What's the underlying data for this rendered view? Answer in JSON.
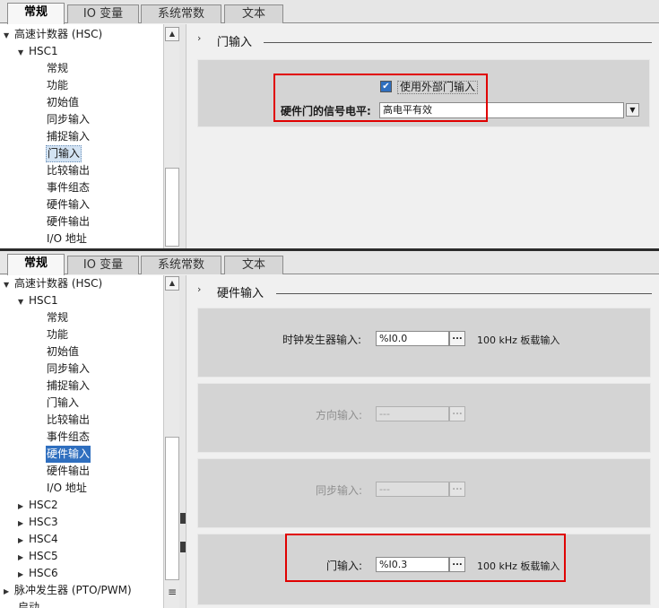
{
  "tabs": [
    "常规",
    "IO 变量",
    "系统常数",
    "文本"
  ],
  "top": {
    "tree": [
      {
        "label": "高速计数器 (HSC)",
        "expander": "▼"
      },
      {
        "label": "HSC1",
        "expander": "▼"
      },
      {
        "label": "常规"
      },
      {
        "label": "功能"
      },
      {
        "label": "初始值"
      },
      {
        "label": "同步输入"
      },
      {
        "label": "捕捉输入"
      },
      {
        "label": "门输入"
      },
      {
        "label": "比较输出"
      },
      {
        "label": "事件组态"
      },
      {
        "label": "硬件输入"
      },
      {
        "label": "硬件输出"
      },
      {
        "label": "I/O 地址"
      }
    ],
    "section_title": "门输入",
    "checkbox_label": "使用外部门输入",
    "checkbox_mark": "✔",
    "signal_level_label": "硬件门的信号电平:",
    "signal_level_value": "高电平有效"
  },
  "bottom": {
    "tree": [
      {
        "label": "高速计数器 (HSC)",
        "expander": "▼"
      },
      {
        "label": "HSC1",
        "expander": "▼"
      },
      {
        "label": "常规"
      },
      {
        "label": "功能"
      },
      {
        "label": "初始值"
      },
      {
        "label": "同步输入"
      },
      {
        "label": "捕捉输入"
      },
      {
        "label": "门输入"
      },
      {
        "label": "比较输出"
      },
      {
        "label": "事件组态"
      },
      {
        "label": "硬件输入"
      },
      {
        "label": "硬件输出"
      },
      {
        "label": "I/O 地址"
      },
      {
        "label": "HSC2",
        "expander": "▶"
      },
      {
        "label": "HSC3",
        "expander": "▶"
      },
      {
        "label": "HSC4",
        "expander": "▶"
      },
      {
        "label": "HSC5",
        "expander": "▶"
      },
      {
        "label": "HSC6",
        "expander": "▶"
      },
      {
        "label": "脉冲发生器 (PTO/PWM)",
        "expander": "▶"
      },
      {
        "label": "启动"
      }
    ],
    "section_title": "硬件输入",
    "rows": {
      "clock": {
        "label": "时钟发生器输入:",
        "value": "%I0.0",
        "note": "100 kHz 板载输入"
      },
      "direction": {
        "label": "方向输入:",
        "value": "---"
      },
      "sync": {
        "label": "同步输入:",
        "value": "---"
      },
      "gate": {
        "label": "门输入:",
        "value": "%I0.3",
        "note": "100 kHz 板载输入"
      }
    },
    "browse": "..."
  },
  "icons": {
    "scroll_up": "▲",
    "scroll_down": "▼",
    "dropdown": "▼",
    "section_chevron": "›",
    "scroll_grip": "≡"
  }
}
